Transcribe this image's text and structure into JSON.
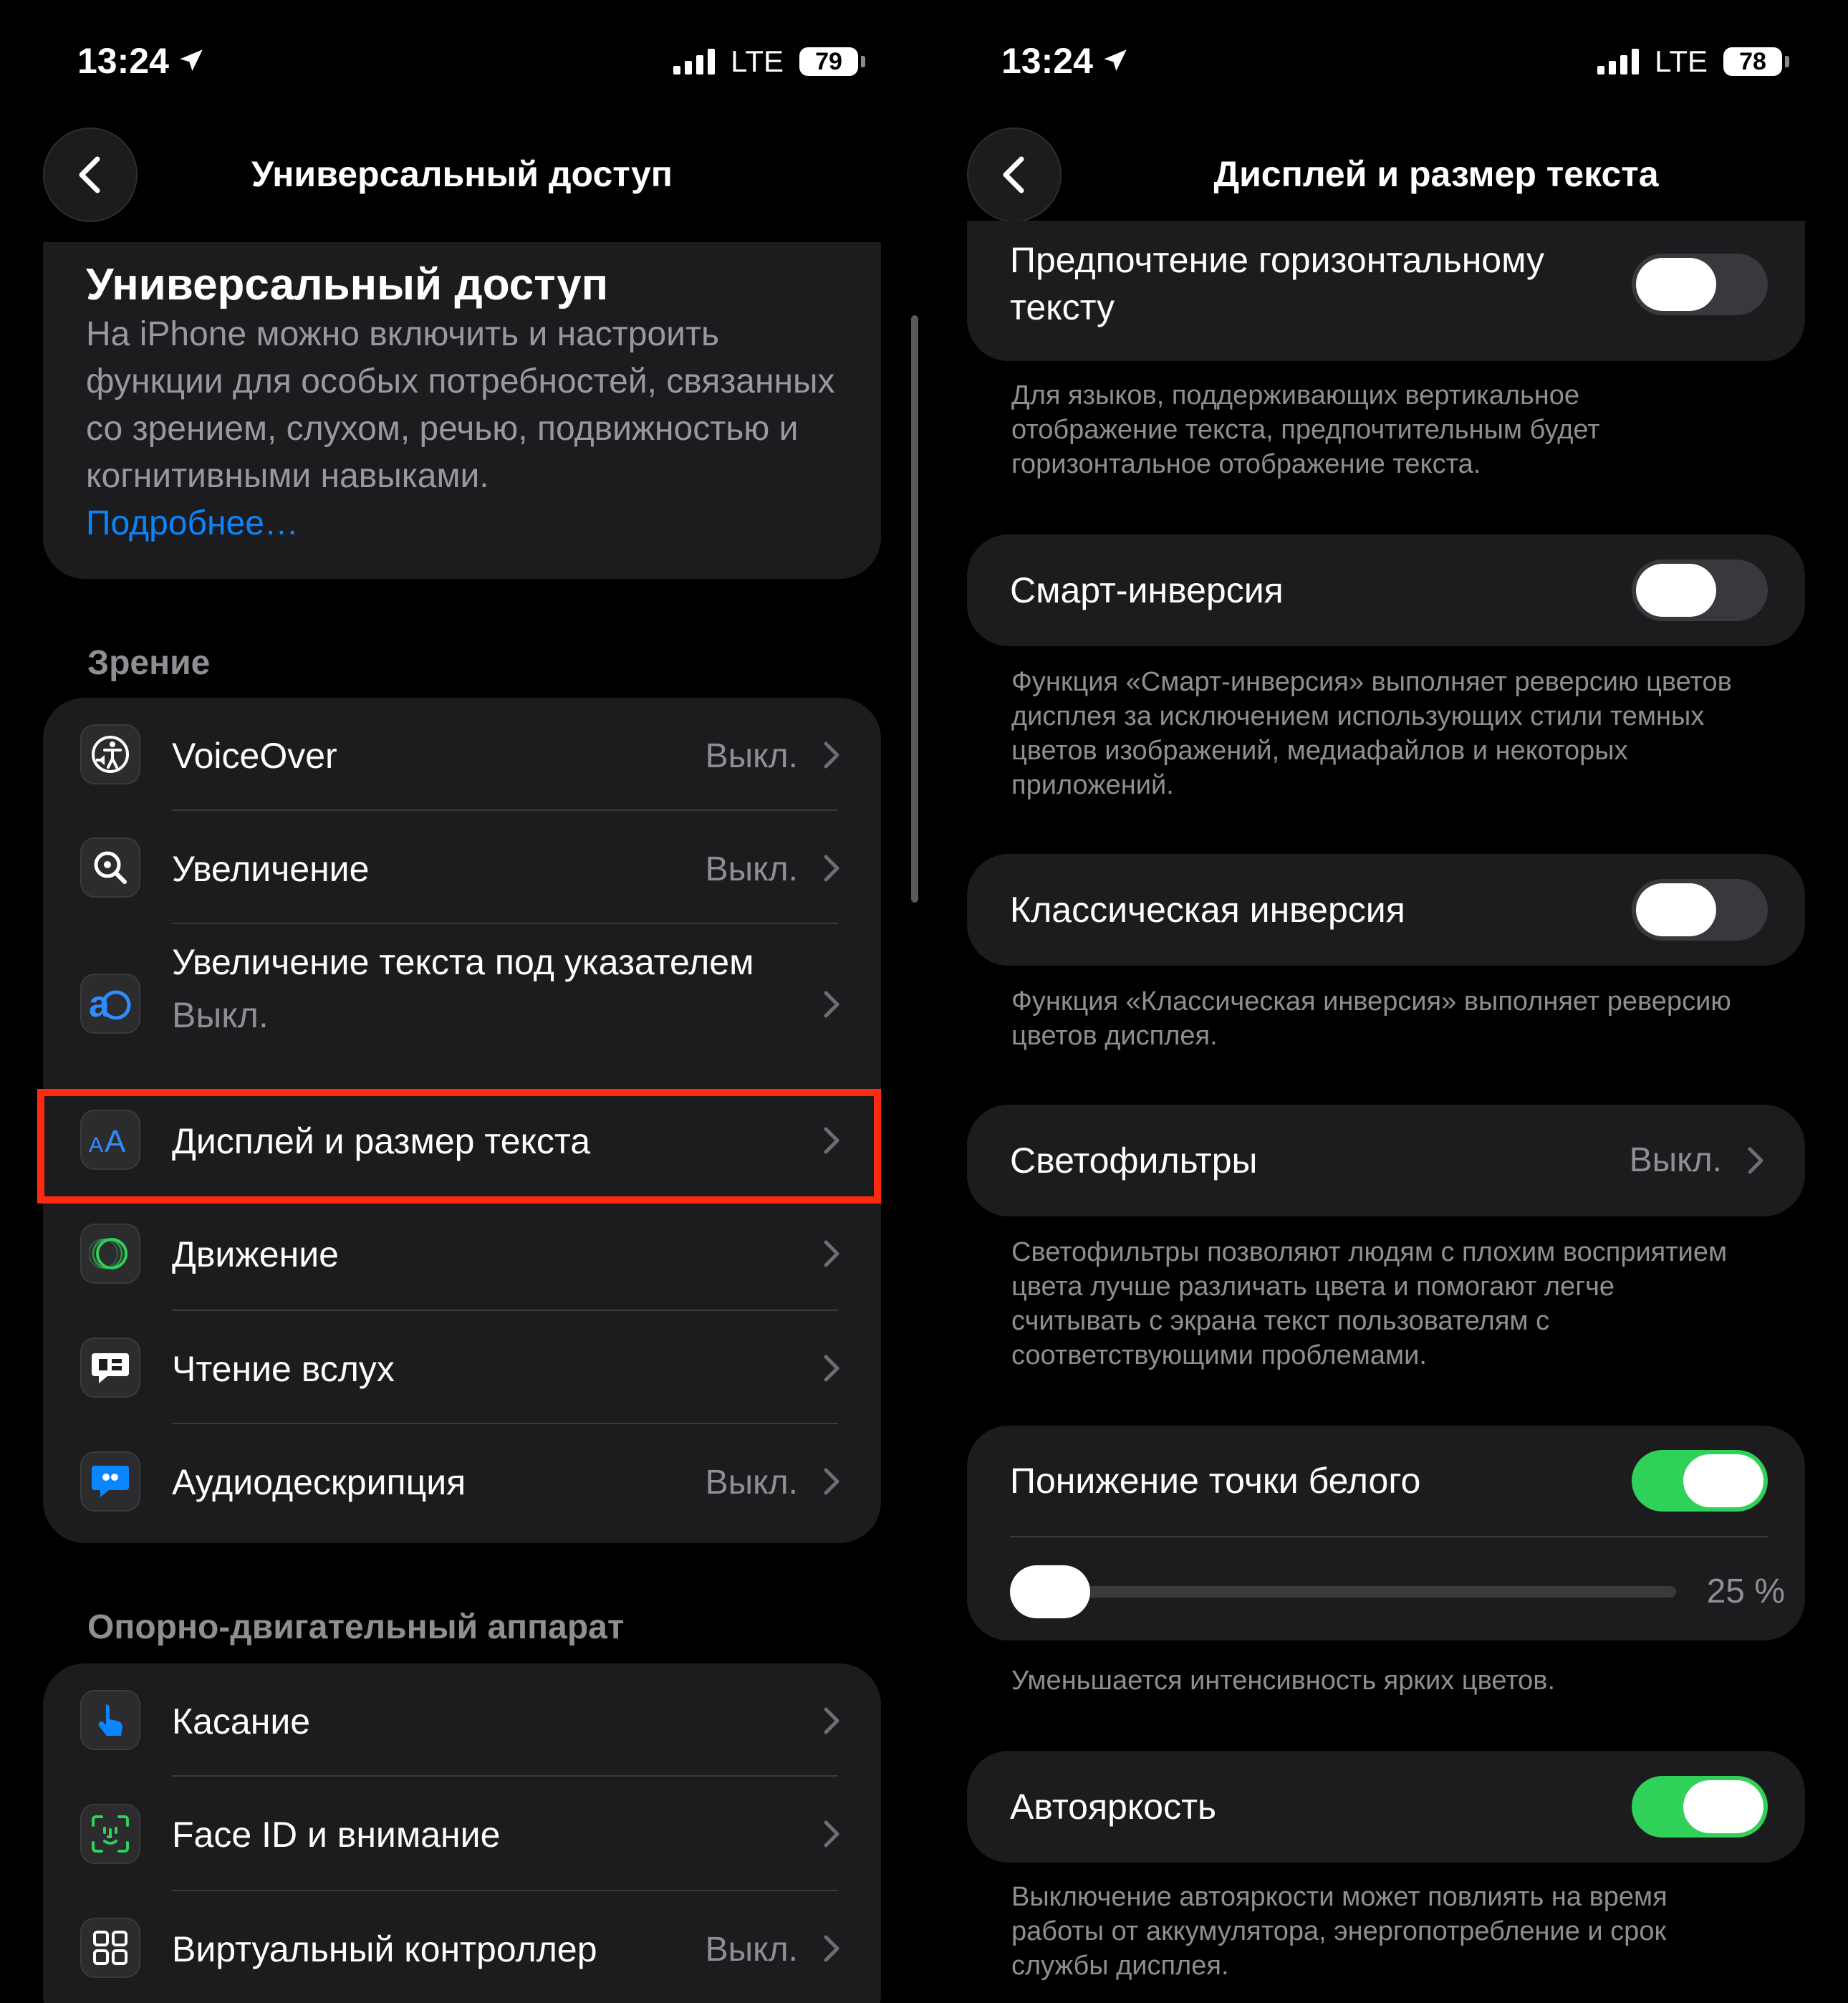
{
  "left_screen": {
    "status": {
      "time": "13:24",
      "network": "LTE",
      "battery": "79"
    },
    "nav": {
      "title": "Универсальный доступ"
    },
    "about": {
      "title": "Универсальный доступ",
      "description": "На iPhone можно включить и настроить функции для особых потребностей, связанных со зрением, слухом, речью, подвижностью и когнитивными навыками.",
      "link": "Подробнее…"
    },
    "vision": {
      "header": "Зрение",
      "items": [
        {
          "label": "VoiceOver",
          "value": "Выкл.",
          "icon": "voiceover-icon"
        },
        {
          "label": "Увеличение",
          "value": "Выкл.",
          "icon": "zoom-icon"
        },
        {
          "label": "Увеличение текста под указателем",
          "value": "Выкл.",
          "icon": "hover-text-icon"
        },
        {
          "label": "Дисплей и размер текста",
          "value": "",
          "icon": "text-size-icon",
          "highlighted": true
        },
        {
          "label": "Движение",
          "value": "",
          "icon": "motion-icon"
        },
        {
          "label": "Чтение вслух",
          "value": "",
          "icon": "spoken-content-icon"
        },
        {
          "label": "Аудиодескрипция",
          "value": "Выкл.",
          "icon": "audio-description-icon"
        }
      ]
    },
    "motor": {
      "header": "Опорно-двигательный аппарат",
      "items": [
        {
          "label": "Касание",
          "value": "",
          "icon": "touch-icon"
        },
        {
          "label": "Face ID и внимание",
          "value": "",
          "icon": "face-id-icon"
        },
        {
          "label": "Виртуальный контроллер",
          "value": "Выкл.",
          "icon": "switch-control-icon"
        }
      ]
    }
  },
  "right_screen": {
    "status": {
      "time": "13:24",
      "network": "LTE",
      "battery": "78"
    },
    "nav": {
      "title": "Дисплей и размер текста"
    },
    "horizontal_text": {
      "label": "Предпочтение горизонтальному тексту",
      "on": false,
      "footnote": "Для языков, поддерживающих вертикальное отображение текста, предпочтительным будет горизонтальное отображение текста."
    },
    "smart_invert": {
      "label": "Смарт-инверсия",
      "on": false,
      "footnote": "Функция «Смарт-инверсия» выполняет реверсию цветов дисплея за исключением использующих стили темных цветов изображений, медиафайлов и некоторых приложений."
    },
    "classic_invert": {
      "label": "Классическая инверсия",
      "on": false,
      "footnote": "Функция «Классическая инверсия» выполняет реверсию цветов дисплея."
    },
    "color_filters": {
      "label": "Светофильтры",
      "value": "Выкл.",
      "footnote": "Светофильтры позволяют людям с плохим восприятием цвета лучше различать цвета и помогают легче считывать с экрана текст пользователям с соответствующими проблемами."
    },
    "reduce_white_point": {
      "label": "Понижение точки белого",
      "on": true,
      "level": "25 %",
      "level_fraction": 0.25,
      "footnote": "Уменьшается интенсивность ярких цветов."
    },
    "auto_brightness": {
      "label": "Автояркость",
      "on": true,
      "footnote": "Выключение автояркости может повлиять на время работы от аккумулятора, энергопотребление и срок службы дисплея."
    }
  },
  "colors": {
    "background": "#000000",
    "card": "#1c1c1e",
    "accent_link": "#0a84ff",
    "toggle_on": "#30d158",
    "highlight": "#ff2a12",
    "secondary_text": "#8e8e93"
  }
}
